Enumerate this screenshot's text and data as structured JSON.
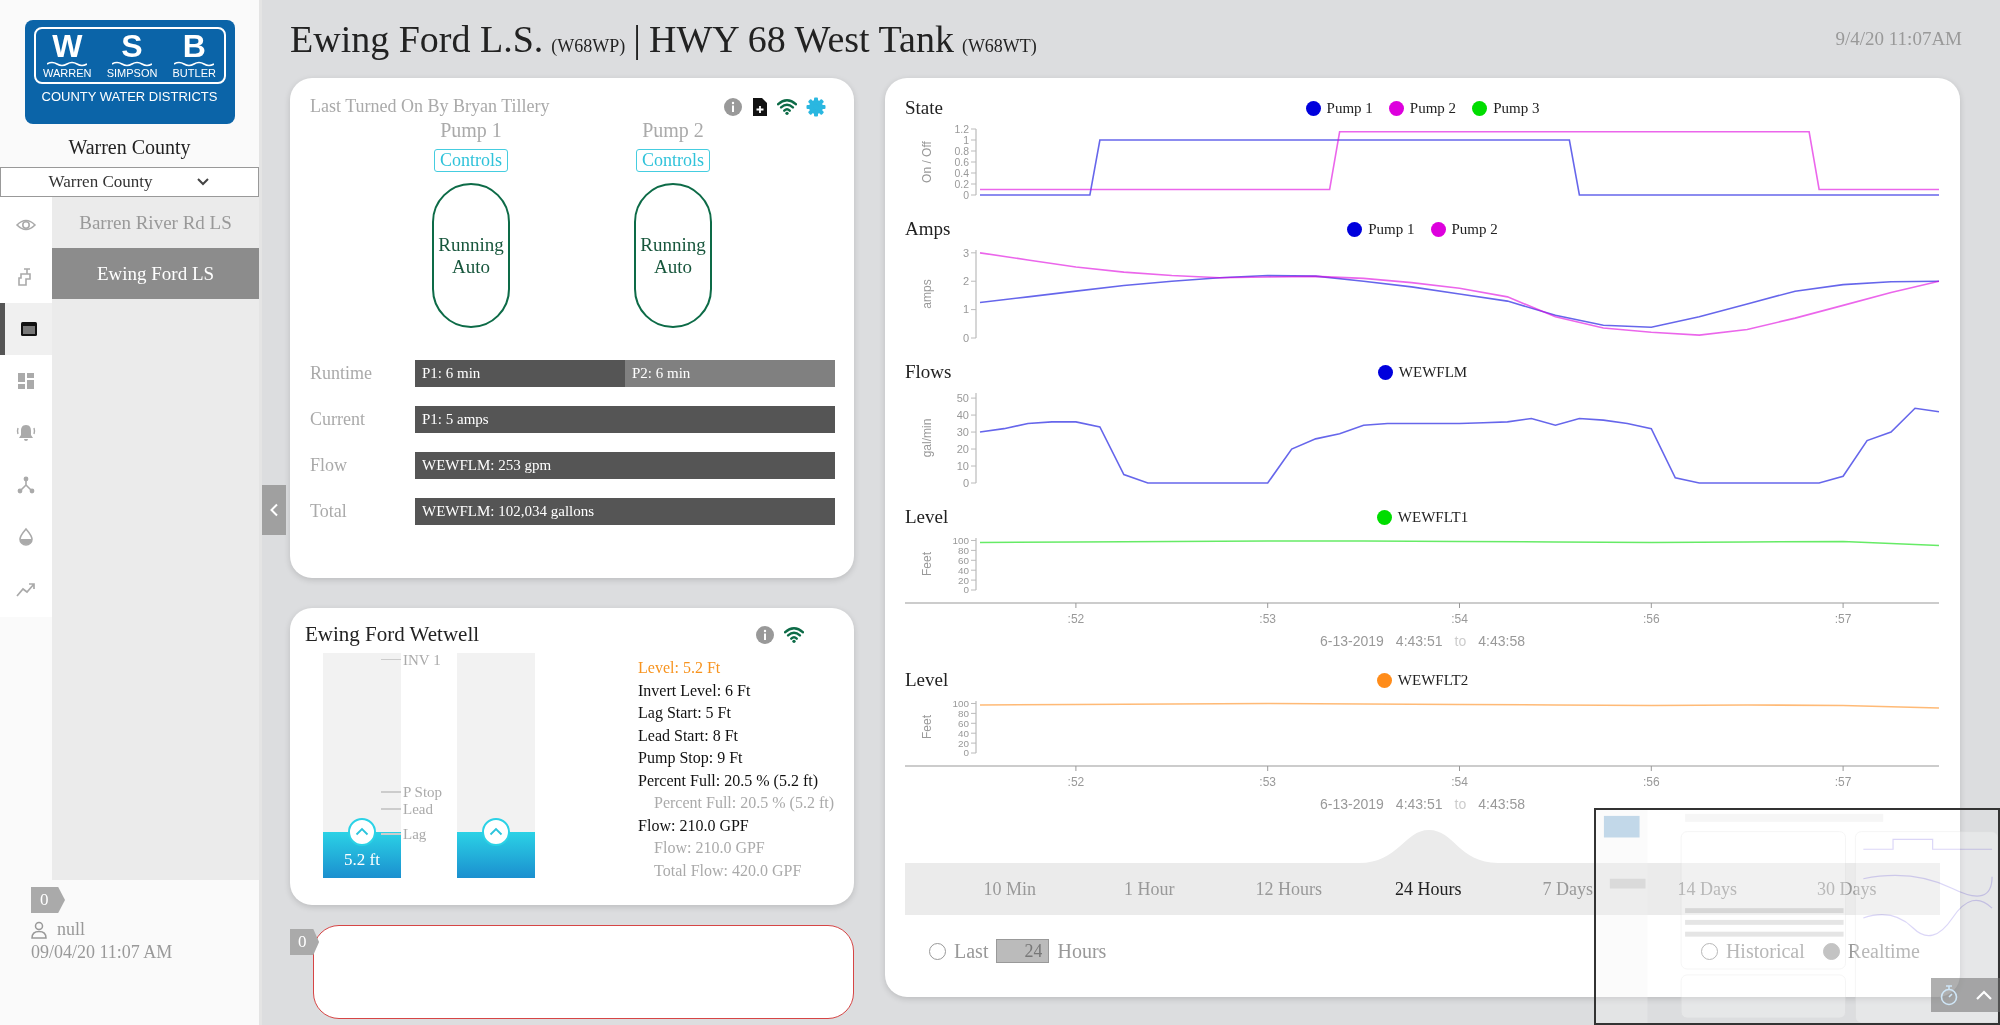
{
  "sidebar": {
    "logo": {
      "letters": [
        "W",
        "S",
        "B"
      ],
      "names": [
        "WARREN",
        "SIMPSON",
        "BUTLER"
      ],
      "tagline": "COUNTY WATER DISTRICTS"
    },
    "region_title": "Warren County",
    "region_select": {
      "value": "Warren County"
    },
    "nav_icons": [
      {
        "selected": false
      },
      {
        "selected": false
      },
      {
        "selected": true
      },
      {
        "selected": false
      },
      {
        "selected": false
      },
      {
        "selected": false
      },
      {
        "selected": false
      },
      {
        "selected": false
      }
    ],
    "stations": [
      {
        "label": "Barren River Rd LS",
        "selected": false
      },
      {
        "label": "Ewing Ford LS",
        "selected": true
      }
    ],
    "alert_count": "0",
    "user": "null",
    "timestamp": "09/04/20 11:07 AM"
  },
  "header": {
    "stations": [
      {
        "name": "Ewing Ford L.S.",
        "code": "(W68WP)"
      },
      {
        "name": "HWY 68 West Tank",
        "code": "(W68WT)"
      }
    ],
    "separator": "|",
    "timestamp": "9/4/20 11:07AM"
  },
  "pump_card": {
    "caption": "Last Turned On By Bryan Tillery",
    "pumps": [
      {
        "name": "Pump 1",
        "control_label": "Controls",
        "status": "Running Auto"
      },
      {
        "name": "Pump 2",
        "control_label": "Controls",
        "status": "Running Auto"
      }
    ],
    "rows": [
      {
        "label": "Runtime",
        "segments": [
          "P1: 6 min",
          "P2: 6 min"
        ]
      },
      {
        "label": "Current",
        "segments": [
          "P1: 5 amps"
        ]
      },
      {
        "label": "Flow",
        "segments": [
          "WEWFLM: 253 gpm"
        ]
      },
      {
        "label": "Total",
        "segments": [
          "WEWFLM: 102,034 gallons"
        ]
      }
    ]
  },
  "wetwell_card": {
    "title": "Ewing Ford Wetwell",
    "tanks": [
      {
        "level": 0.205,
        "reading": "5.2 ft",
        "markers": [
          "INV 1",
          "P Stop",
          "Lead",
          "Lag"
        ]
      },
      {
        "level": 0.205
      }
    ],
    "stats": [
      {
        "text": "Level: 5.2 Ft",
        "kind": "highlight"
      },
      {
        "text": "Invert Level: 6 Ft",
        "kind": "primary"
      },
      {
        "text": "Lag Start: 5 Ft",
        "kind": "primary"
      },
      {
        "text": "Lead Start: 8 Ft",
        "kind": "primary"
      },
      {
        "text": "Pump Stop: 9 Ft",
        "kind": "primary"
      },
      {
        "text": "Percent Full: 20.5 % (5.2 ft)",
        "kind": "primary"
      },
      {
        "text": "Percent Full: 20.5 % (5.2 ft)",
        "kind": "secondary"
      },
      {
        "text": "Flow: 210.0 GPF",
        "kind": "primary"
      },
      {
        "text": "Flow: 210.0 GPF",
        "kind": "secondary"
      },
      {
        "text": "Total Flow: 420.0 GPF",
        "kind": "secondary"
      }
    ]
  },
  "alarm_panel": {
    "count": "0"
  },
  "trends": {
    "charts": [
      {
        "title": "State",
        "chart_data": {
          "type": "line",
          "legend": true,
          "ylabel": "On / Off",
          "categories": [
            null,
            null,
            null,
            null,
            null,
            null,
            null,
            null,
            null,
            null,
            null,
            null,
            null,
            null,
            null,
            null,
            null,
            null,
            null,
            null,
            null,
            null,
            null,
            null,
            null,
            null,
            null,
            null,
            null,
            null,
            null,
            null,
            null,
            null,
            null,
            null,
            null,
            null,
            null,
            null,
            null,
            null,
            null,
            null,
            null,
            null,
            null,
            null,
            null,
            null,
            null,
            null,
            null,
            null,
            null,
            null,
            null,
            null,
            null,
            null,
            null,
            null,
            null,
            null,
            null,
            null,
            null,
            null,
            null,
            null,
            null,
            null,
            null,
            null,
            null,
            null,
            null,
            null,
            null,
            null,
            null,
            null,
            null,
            null,
            null,
            null,
            null,
            null,
            null,
            null,
            null,
            null,
            null,
            null,
            null,
            null,
            null
          ],
          "ylim": [
            0,
            1.2
          ],
          "yticks": [
            {
              "value": 0,
              "label": "0"
            },
            {
              "value": 0.2,
              "label": "0.2"
            },
            {
              "value": 0.4,
              "label": "0.4"
            },
            {
              "value": 0.6,
              "label": "0.6"
            },
            {
              "value": 0.8,
              "label": "0.8"
            },
            {
              "value": 1,
              "label": "1"
            },
            {
              "value": 1.2,
              "label": "1.2"
            }
          ],
          "series": [
            {
              "name": "Pump 1",
              "color": "#0000dd",
              "values": [
                0,
                0,
                0,
                0,
                0,
                0,
                0,
                0,
                0,
                0,
                0,
                0,
                1,
                1,
                1,
                1,
                1,
                1,
                1,
                1,
                1,
                1,
                1,
                1,
                1,
                1,
                1,
                1,
                1,
                1,
                1,
                1,
                1,
                1,
                1,
                1,
                1,
                1,
                1,
                1,
                1,
                1,
                1,
                1,
                1,
                1,
                1,
                1,
                1,
                1,
                1,
                1,
                1,
                1,
                1,
                1,
                1,
                1,
                1,
                1,
                0,
                0,
                0,
                0,
                0,
                0,
                0,
                0,
                0,
                0,
                0,
                0,
                0,
                0,
                0,
                0,
                0,
                0,
                0,
                0,
                0,
                0,
                0,
                0,
                0,
                0,
                0,
                0,
                0,
                0,
                0,
                0,
                0,
                0,
                0,
                0,
                0
              ]
            },
            {
              "name": "Pump 2",
              "color": "#dd00dd",
              "values": [
                0.1,
                0.1,
                0.1,
                0.1,
                0.1,
                0.1,
                0.1,
                0.1,
                0.1,
                0.1,
                0.1,
                0.1,
                0.1,
                0.1,
                0.1,
                0.1,
                0.1,
                0.1,
                0.1,
                0.1,
                0.1,
                0.1,
                0.1,
                0.1,
                0.1,
                0.1,
                0.1,
                0.1,
                0.1,
                0.1,
                0.1,
                0.1,
                0.1,
                0.1,
                0.1,
                0.1,
                1.15,
                1.15,
                1.15,
                1.15,
                1.15,
                1.15,
                1.15,
                1.15,
                1.15,
                1.15,
                1.15,
                1.15,
                1.15,
                1.15,
                1.15,
                1.15,
                1.15,
                1.15,
                1.15,
                1.15,
                1.15,
                1.15,
                1.15,
                1.15,
                1.15,
                1.15,
                1.15,
                1.15,
                1.15,
                1.15,
                1.15,
                1.15,
                1.15,
                1.15,
                1.15,
                1.15,
                1.15,
                1.15,
                1.15,
                1.15,
                1.15,
                1.15,
                1.15,
                1.15,
                1.15,
                1.15,
                1.15,
                1.15,
                0.1,
                0.1,
                0.1,
                0.1,
                0.1,
                0.1,
                0.1,
                0.1,
                0.1,
                0.1,
                0.1,
                0.1,
                0.1
              ]
            },
            {
              "name": "Pump 3",
              "color": "#00dd00",
              "values": [
                null,
                null,
                null,
                null,
                null,
                null,
                null,
                null,
                null,
                null,
                null,
                null,
                null,
                null,
                null,
                null,
                null,
                null,
                null,
                null,
                null,
                null,
                null,
                null,
                null,
                null,
                null,
                null,
                null,
                null,
                null,
                null,
                null,
                null,
                null,
                null,
                null,
                null,
                null,
                null,
                null,
                null,
                null,
                null,
                null,
                null,
                null,
                null,
                null,
                null,
                null,
                null,
                null,
                null,
                null,
                null,
                null,
                null,
                null,
                null,
                null,
                null,
                null,
                null,
                null,
                null,
                null,
                null,
                null,
                null,
                null,
                null,
                null,
                null,
                null,
                null,
                null,
                null,
                null,
                null,
                null,
                null,
                null,
                null,
                null,
                null,
                null,
                null,
                null,
                null,
                null,
                null,
                null,
                null,
                null,
                null,
                null
              ]
            }
          ]
        }
      },
      {
        "title": "Amps",
        "chart_data": {
          "type": "line",
          "legend": true,
          "ylabel": "amps",
          "categories": [
            null,
            null,
            null,
            null,
            null,
            null,
            null,
            null,
            null,
            null,
            null,
            null,
            null,
            null,
            null,
            null,
            null,
            null,
            null,
            null,
            null
          ],
          "ylim": [
            0,
            3.1
          ],
          "yticks": [
            0,
            1,
            2,
            3
          ],
          "series": [
            {
              "name": "Pump 1",
              "color": "#0000dd",
              "values": [
                1.25,
                1.45,
                1.65,
                1.85,
                2.0,
                2.12,
                2.2,
                2.18,
                2.0,
                1.8,
                1.55,
                1.3,
                0.8,
                0.45,
                0.38,
                0.75,
                1.2,
                1.65,
                1.88,
                1.98,
                2.0
              ]
            },
            {
              "name": "Pump 2",
              "color": "#dd00dd",
              "values": [
                3.0,
                2.75,
                2.5,
                2.32,
                2.2,
                2.12,
                2.15,
                2.17,
                2.1,
                1.95,
                1.75,
                1.45,
                0.75,
                0.35,
                0.2,
                0.1,
                0.3,
                0.7,
                1.15,
                1.6,
                2.0
              ]
            }
          ]
        }
      },
      {
        "title": "Flows",
        "chart_data": {
          "type": "line",
          "legend": true,
          "ylabel": "gal/min",
          "categories": [
            null,
            null,
            null,
            null,
            null,
            null,
            null,
            null,
            null,
            null,
            null,
            null,
            null,
            null,
            null,
            null,
            null,
            null,
            null,
            null,
            null,
            null,
            null,
            null,
            null,
            null,
            null,
            null,
            null,
            null,
            null,
            null,
            null,
            null,
            null,
            null,
            null,
            null,
            null,
            null,
            null
          ],
          "ylim": [
            0,
            53
          ],
          "yticks": [
            0,
            10,
            20,
            30,
            40,
            50
          ],
          "series": [
            {
              "name": "WEWFLM",
              "color": "#0000dd",
              "values": [
                30,
                32,
                35,
                36,
                36,
                33,
                5,
                0,
                0,
                0,
                0,
                0,
                0,
                20,
                26,
                29,
                34,
                35,
                35,
                35,
                35,
                35.5,
                36,
                38,
                34,
                38,
                37,
                35,
                32,
                3,
                0,
                0,
                0,
                0,
                0,
                0,
                4,
                25,
                30,
                44,
                42
              ]
            }
          ]
        }
      },
      {
        "title": "Level",
        "range": {
          "date": "6-13-2019",
          "from": "4:43:51",
          "to_word": "to",
          "to": "4:43:58"
        },
        "chart_data": {
          "type": "line",
          "legend": true,
          "ylabel": "Feet",
          "categories": [
            null,
            ":52",
            null,
            ":53",
            null,
            ":54",
            null,
            ":56",
            null,
            ":57",
            null
          ],
          "ylim": [
            0,
            105
          ],
          "yticks": [
            0,
            20,
            40,
            60,
            80,
            100
          ],
          "series": [
            {
              "name": "WEWFLT1",
              "color": "#00dd00",
              "values": [
                96,
                97,
                98,
                99,
                99,
                98,
                97,
                96,
                97,
                98,
                90
              ]
            }
          ]
        }
      },
      {
        "title": "Level",
        "range": {
          "date": "6-13-2019",
          "from": "4:43:51",
          "to_word": "to",
          "to": "4:43:58"
        },
        "chart_data": {
          "type": "line",
          "legend": true,
          "ylabel": "Feet",
          "categories": [
            null,
            ":52",
            null,
            ":53",
            null,
            ":54",
            null,
            ":56",
            null,
            ":57",
            null
          ],
          "ylim": [
            0,
            105
          ],
          "yticks": [
            0,
            20,
            40,
            60,
            80,
            100
          ],
          "series": [
            {
              "name": "WEWFLT2",
              "color": "#ff8c1a",
              "values": [
                97,
                98,
                99,
                100,
                99,
                98,
                97,
                96,
                97,
                96,
                91
              ]
            }
          ]
        }
      }
    ],
    "ranges": [
      {
        "label": "10 Min",
        "selected": false
      },
      {
        "label": "1 Hour",
        "selected": false
      },
      {
        "label": "12 Hours",
        "selected": false
      },
      {
        "label": "24 Hours",
        "selected": true
      },
      {
        "label": "7 Days",
        "selected": false
      },
      {
        "label": "14 Days",
        "selected": false
      },
      {
        "label": "30 Days",
        "selected": false
      }
    ],
    "last": {
      "label": "Last",
      "value": "24",
      "unit": "Hours",
      "selected": false
    },
    "modes": [
      {
        "label": "Historical",
        "selected": false
      },
      {
        "label": "Realtime",
        "selected": true
      }
    ]
  }
}
